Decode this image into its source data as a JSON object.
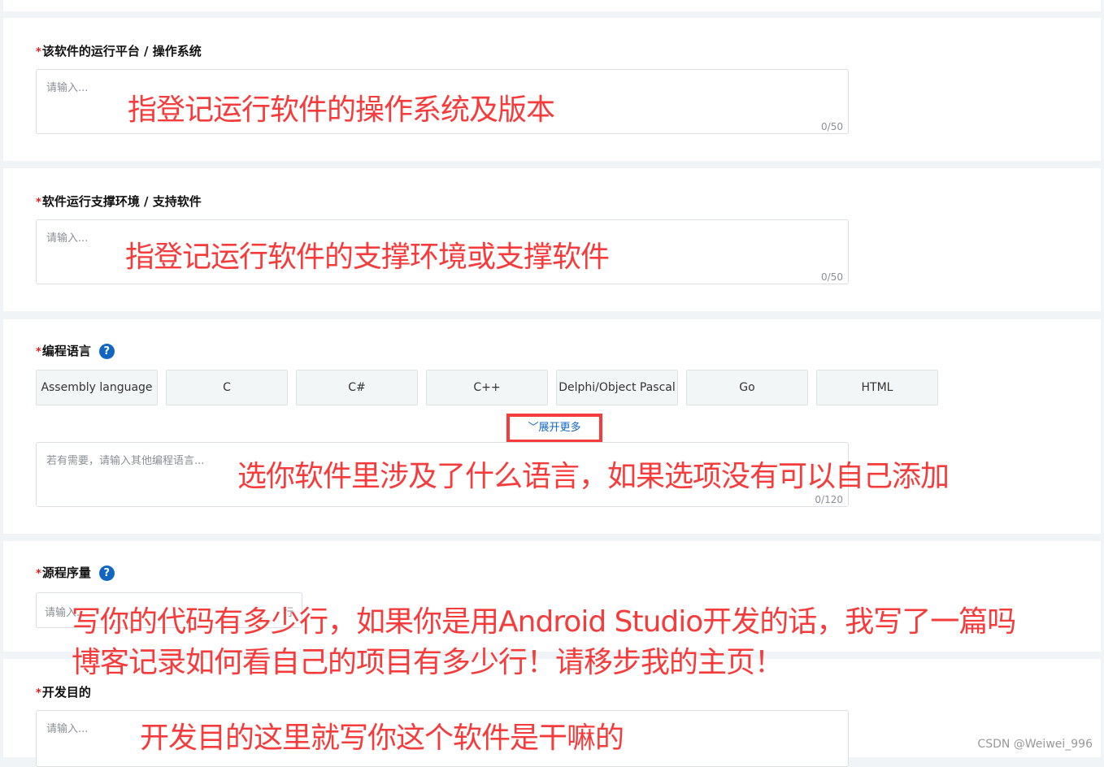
{
  "fields": {
    "platform": {
      "label": "该软件的运行平台 / 操作系统",
      "placeholder": "请输入...",
      "count": "0/50",
      "annotation": "指登记运行软件的操作系统及版本"
    },
    "env": {
      "label": "软件运行支撑环境 / 支持软件",
      "placeholder": "请输入...",
      "count": "0/50",
      "annotation": "指登记运行软件的支撑环境或支撑软件"
    },
    "lang": {
      "label": "编程语言",
      "help": "?",
      "options": [
        "Assembly language",
        "C",
        "C#",
        "C++",
        "Delphi/Object Pascal",
        "Go",
        "HTML"
      ],
      "expand": "展开更多",
      "placeholder": "若有需要，请输入其他编程语言...",
      "count": "0/120",
      "annotation": "选你软件里涉及了什么语言，如果选项没有可以自己添加"
    },
    "loc": {
      "label": "源程序量",
      "help": "?",
      "placeholder": "请输入...",
      "unit": "行",
      "annotation1": "写你的代码有多少行，如果你是用Android Studio开发的话，我写了一篇吗",
      "annotation2": "博客记录如何看自己的项目有多少行！请移步我的主页！"
    },
    "purpose": {
      "label": "开发目的",
      "placeholder": "请输入...",
      "annotation": "开发目的这里就写你这个软件是干嘛的"
    }
  },
  "required_mark": "*",
  "watermark": "CSDN @Weiwei_996"
}
